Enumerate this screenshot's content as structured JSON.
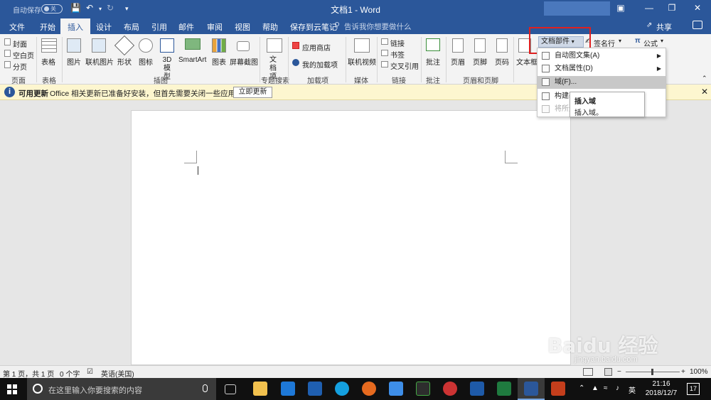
{
  "titlebar": {
    "autosave_label": "自动保存",
    "autosave_state": "关",
    "doc_title": "文档1 - Word",
    "account": ""
  },
  "tabs": {
    "items": [
      "文件",
      "开始",
      "插入",
      "设计",
      "布局",
      "引用",
      "邮件",
      "审阅",
      "视图",
      "帮助",
      "保存到云笔记"
    ],
    "active": "插入",
    "tellme": "告诉我你想要做什么",
    "share": "共享"
  },
  "ribbon": {
    "pages": {
      "cover": "封面",
      "blank": "空白页",
      "break": "分页",
      "label": "页面"
    },
    "tables": {
      "table": "表格",
      "label": "表格"
    },
    "illustrations": {
      "picture": "图片",
      "online_picture": "联机图片",
      "shapes": "形状",
      "icons": "图标",
      "model_3d": "3D 模型",
      "smartart": "SmartArt",
      "chart": "图表",
      "screenshot": "屏幕截图",
      "label": "插图"
    },
    "topic_search": {
      "doc_item": "文档项",
      "label": "专题搜索"
    },
    "addins": {
      "store": "应用商店",
      "my_addins": "我的加载项",
      "label": "加载项"
    },
    "media": {
      "online_video": "联机视频",
      "label": "媒体"
    },
    "links": {
      "link": "链接",
      "bookmark": "书签",
      "cross_ref": "交叉引用",
      "label": "链接"
    },
    "comments": {
      "comment": "批注",
      "label": "批注"
    },
    "header_footer": {
      "header": "页眉",
      "footer": "页脚",
      "page_number": "页码",
      "label": "页眉和页脚"
    },
    "text": {
      "textbox": "文本框",
      "doc_parts": "文档部件",
      "signature": "签名行"
    },
    "symbols": {
      "equation": "公式"
    }
  },
  "notification": {
    "title": "可用更新",
    "message": "Office 相关更新已准备好安装，但首先需要关闭一些应用。",
    "button": "立即更新"
  },
  "docparts_menu": {
    "items": [
      {
        "label": "自动图文集(A)",
        "disabled": false,
        "submenu": true
      },
      {
        "label": "文档属性(D)",
        "disabled": false,
        "submenu": true
      },
      {
        "label": "域(F)...",
        "disabled": false,
        "submenu": false,
        "active": true
      },
      {
        "label": "构建基",
        "disabled": false,
        "submenu": false
      },
      {
        "label": "将所选",
        "disabled": true,
        "submenu": false
      }
    ],
    "tooltip_title": "插入域",
    "tooltip_desc": "插入域。"
  },
  "statusbar": {
    "page": "第 1 页，共 1 页",
    "words": "0 个字",
    "language": "英语(美国)",
    "zoom": "100%"
  },
  "taskbar": {
    "search_placeholder": "在这里输入你要搜索的内容",
    "ime": "英",
    "time": "21:16",
    "date": "2018/12/7",
    "notifications": "17"
  },
  "watermark": {
    "text": "Baidu 经验",
    "url": "jingyan.baidu.com"
  },
  "colors": {
    "accent": "#2b579a",
    "notify_bg": "#fdf6cf",
    "highlight": "#e02020"
  }
}
